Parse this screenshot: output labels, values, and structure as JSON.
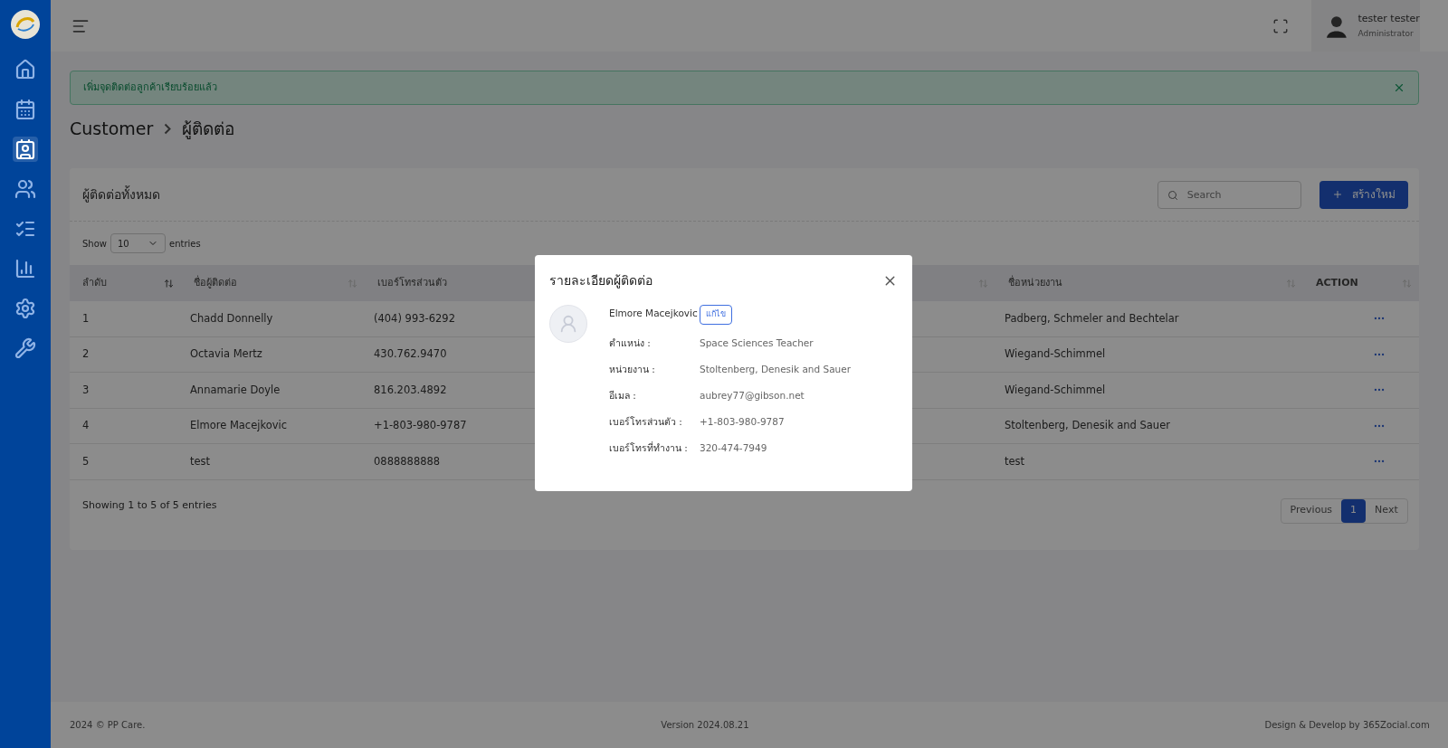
{
  "sidebar": {
    "items": [
      {
        "kind": "home",
        "selected": false
      },
      {
        "kind": "billing",
        "selected": false
      },
      {
        "kind": "contacts",
        "selected": true
      },
      {
        "kind": "team",
        "selected": false
      },
      {
        "kind": "list",
        "selected": false
      },
      {
        "kind": "report",
        "selected": false
      },
      {
        "kind": "settings",
        "selected": false
      },
      {
        "kind": "tools",
        "selected": false
      }
    ]
  },
  "header": {
    "user_name": "tester tester",
    "user_role": "Administrator"
  },
  "alert": {
    "message": "เพิ่มจุดติดต่อลูกค้าเรียบร้อยแล้ว"
  },
  "breadcrumb": [
    "Customer",
    "ผู้ติดต่อ"
  ],
  "card": {
    "title": "ผู้ติดต่อทั้งหมด",
    "search": {
      "placeholder": "Search"
    },
    "create_button": "สร้างใหม่",
    "length_menu": {
      "label_before": "Show",
      "value": "10",
      "label_after": "entries"
    },
    "table": {
      "columns": [
        {
          "label": "ลำดับ",
          "sorted": true
        },
        {
          "label": "ชื่อผู้ติดต่อ",
          "sorted": false
        },
        {
          "label": "เบอร์โทรส่วนตัว"
        },
        {
          "sorted": false
        },
        {
          "label": "ชื่อหน่วยงาน",
          "sorted": false
        },
        {
          "label": "ACTION",
          "sorted": false
        }
      ],
      "rows": [
        {
          "no": "1",
          "name": "Chadd Donnelly",
          "phone": "(404) 993-6292",
          "organization": "Padberg, Schmeler and Bechtelar"
        },
        {
          "no": "2",
          "name": "Octavia Mertz",
          "phone": "430.762.9470",
          "organization": "Wiegand-Schimmel"
        },
        {
          "no": "3",
          "name": "Annamarie Doyle",
          "phone": "816.203.4892",
          "organization": "Wiegand-Schimmel"
        },
        {
          "no": "4",
          "name": "Elmore Macejkovic",
          "phone": "+1-803-980-9787",
          "organization": "Stoltenberg, Denesik and Sauer"
        },
        {
          "no": "5",
          "name": "test",
          "phone": "0888888888",
          "organization": "test"
        }
      ]
    },
    "info": "Showing 1 to 5 of 5 entries",
    "pagination": [
      {
        "label": "Previous",
        "selected": false
      },
      {
        "label": "1",
        "selected": true
      },
      {
        "label": "Next",
        "selected": false
      }
    ]
  },
  "footer": {
    "copyright": "2024 © PP Care.",
    "version": "Version 2024.08.21",
    "credit": "Design & Develop by 365Zocial.com"
  },
  "modal": {
    "title": "รายละเอียดผู้ติดต่อ",
    "name": "Elmore Macejkovic",
    "edit_button": "แก้ไข",
    "fields": [
      {
        "label": "ตำแหน่ง :",
        "value": "Space Sciences Teacher"
      },
      {
        "label": "หน่วยงาน :",
        "value": "Stoltenberg, Denesik and Sauer"
      },
      {
        "label": "อีเมล :",
        "value": "aubrey77@gibson.net"
      },
      {
        "label": "เบอร์โทรส่วนตัว :",
        "value": "+1-803-980-9787"
      },
      {
        "label": "เบอร์โทรที่ทำงาน :",
        "value": "320-474-7949"
      }
    ]
  }
}
